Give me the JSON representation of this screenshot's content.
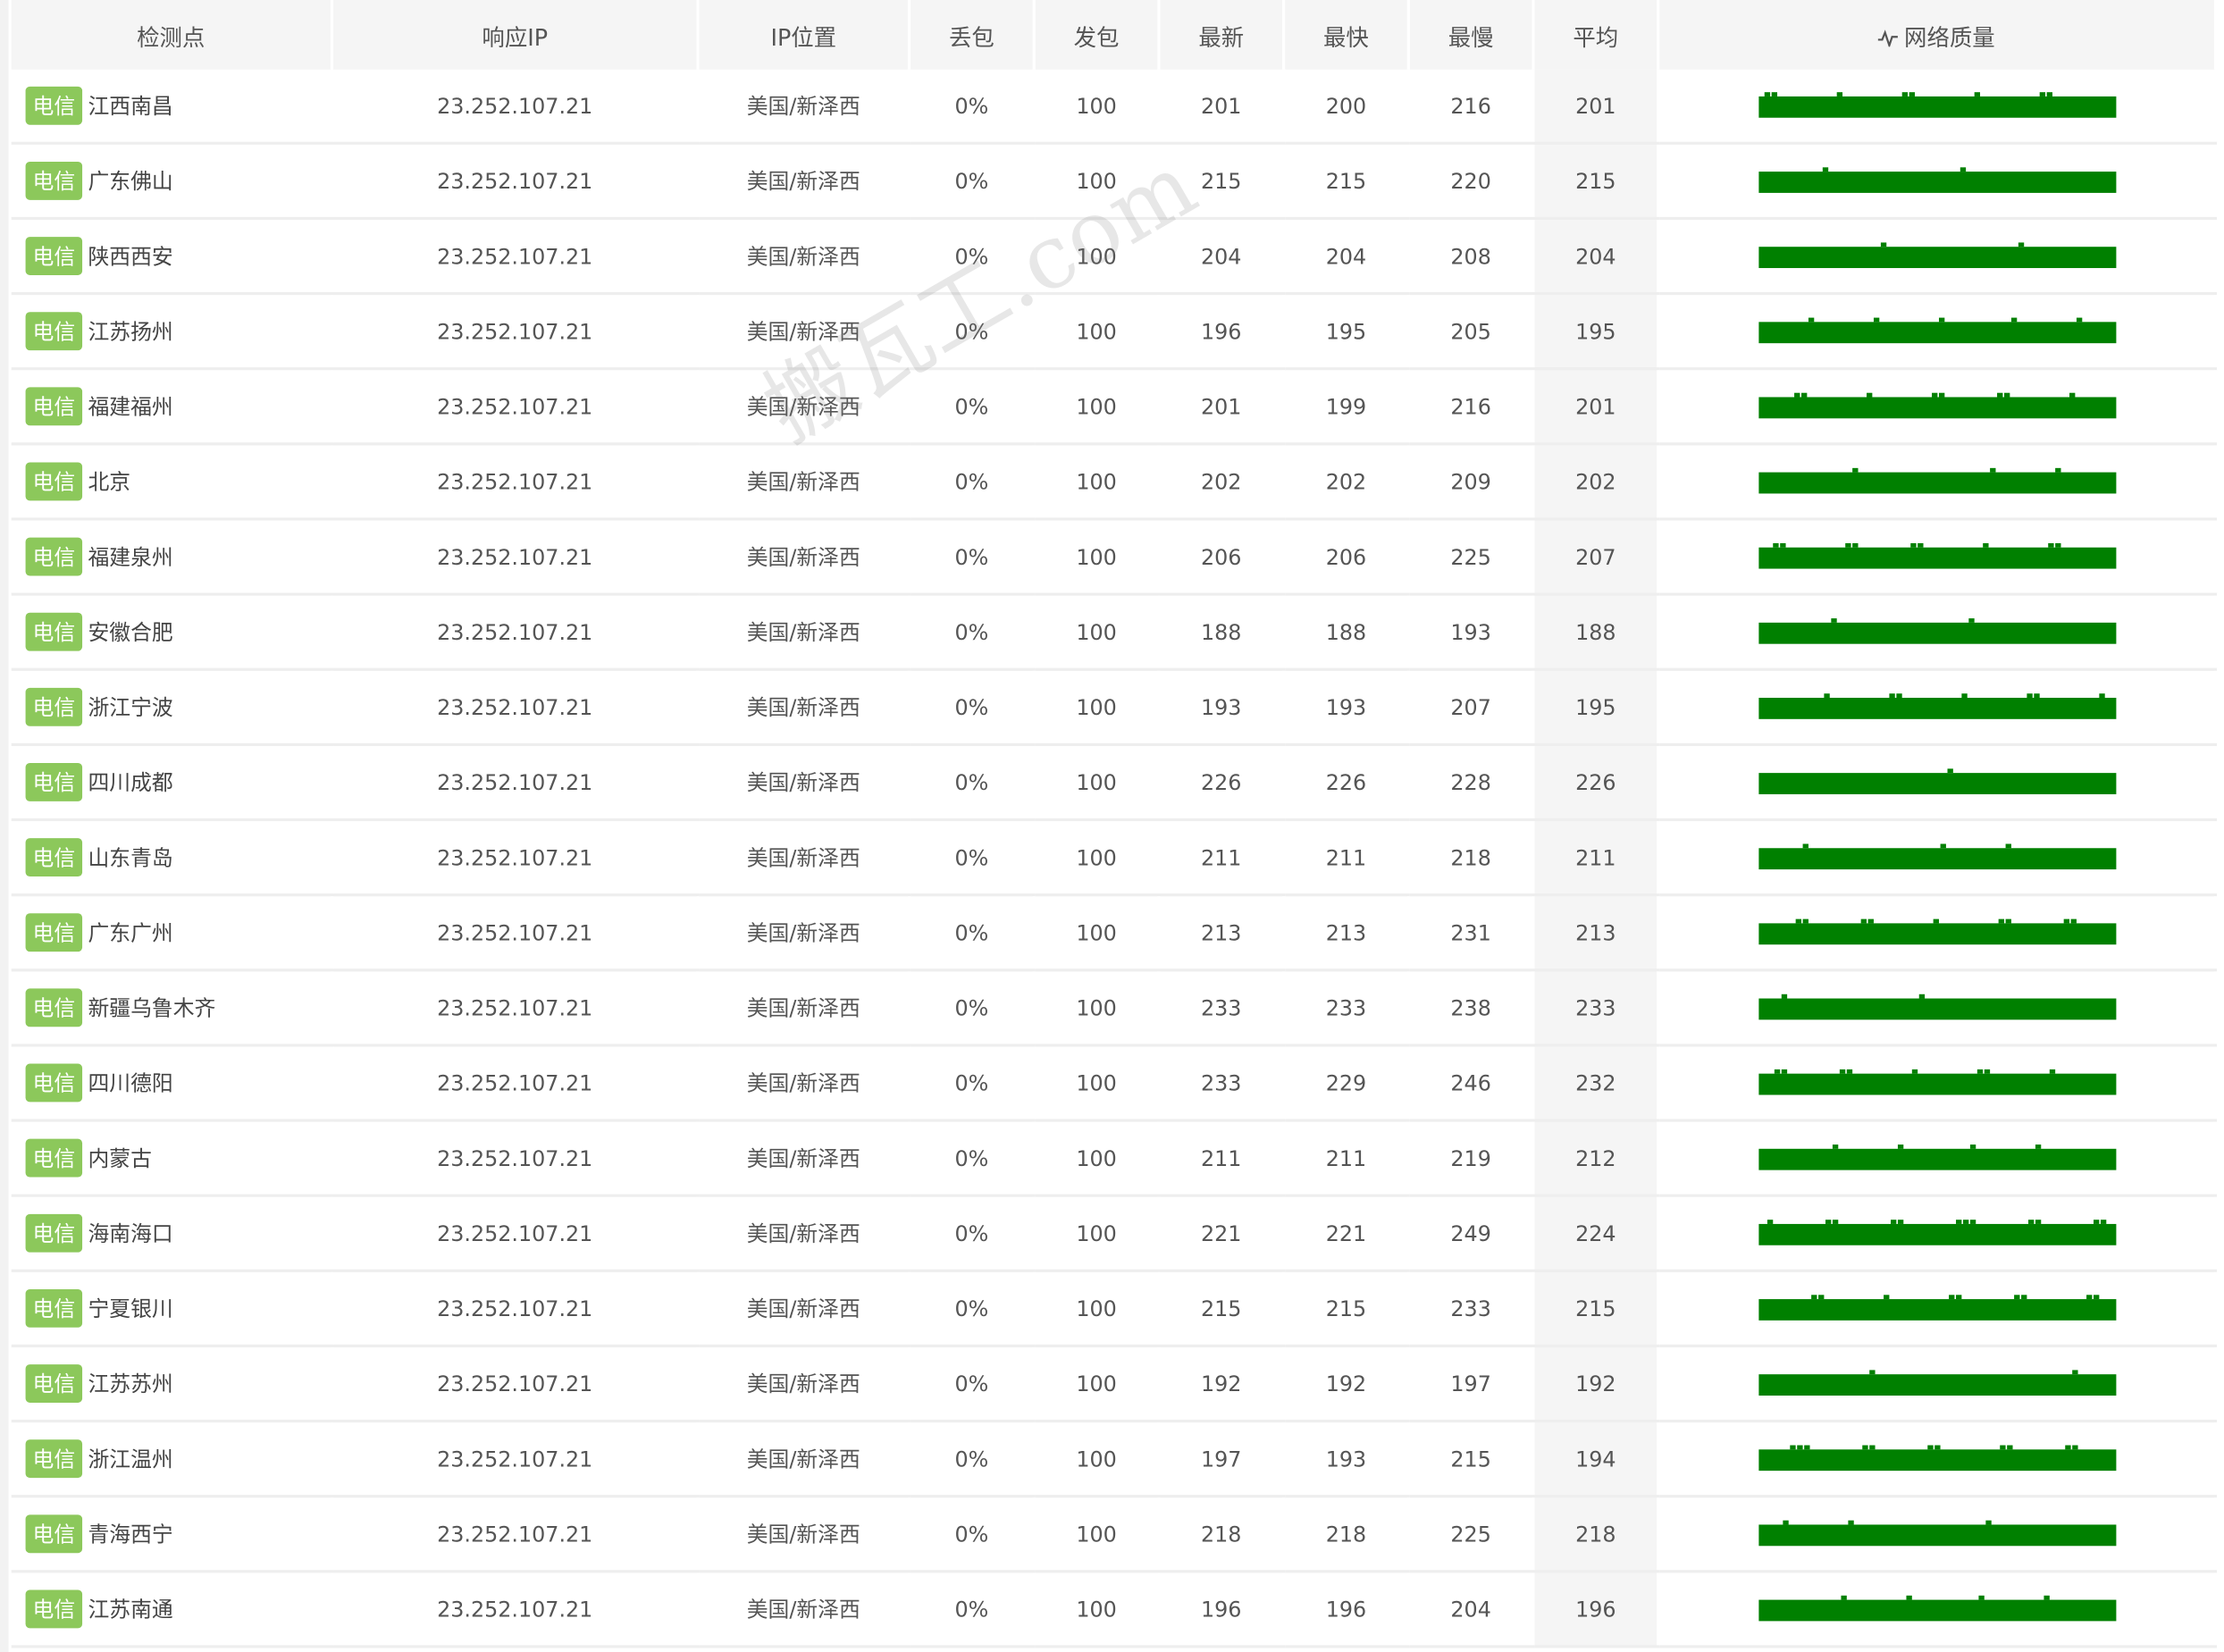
{
  "table": {
    "headers": {
      "node": "检测点",
      "ip": "响应IP",
      "location": "IP位置",
      "loss": "丢包",
      "sent": "发包",
      "latest": "最新",
      "fastest": "最快",
      "slowest": "最慢",
      "average": "平均",
      "quality": "网络质量"
    },
    "rows": [
      {
        "isp": "电信",
        "node": "江西南昌",
        "ip": "23.252.107.21",
        "location": "美国/新泽西",
        "loss": "0%",
        "sent": "100",
        "latest": "201",
        "fastest": "200",
        "slowest": "216",
        "average": "201"
      },
      {
        "isp": "电信",
        "node": "广东佛山",
        "ip": "23.252.107.21",
        "location": "美国/新泽西",
        "loss": "0%",
        "sent": "100",
        "latest": "215",
        "fastest": "215",
        "slowest": "220",
        "average": "215"
      },
      {
        "isp": "电信",
        "node": "陕西西安",
        "ip": "23.252.107.21",
        "location": "美国/新泽西",
        "loss": "0%",
        "sent": "100",
        "latest": "204",
        "fastest": "204",
        "slowest": "208",
        "average": "204"
      },
      {
        "isp": "电信",
        "node": "江苏扬州",
        "ip": "23.252.107.21",
        "location": "美国/新泽西",
        "loss": "0%",
        "sent": "100",
        "latest": "196",
        "fastest": "195",
        "slowest": "205",
        "average": "195"
      },
      {
        "isp": "电信",
        "node": "福建福州",
        "ip": "23.252.107.21",
        "location": "美国/新泽西",
        "loss": "0%",
        "sent": "100",
        "latest": "201",
        "fastest": "199",
        "slowest": "216",
        "average": "201"
      },
      {
        "isp": "电信",
        "node": "北京",
        "ip": "23.252.107.21",
        "location": "美国/新泽西",
        "loss": "0%",
        "sent": "100",
        "latest": "202",
        "fastest": "202",
        "slowest": "209",
        "average": "202"
      },
      {
        "isp": "电信",
        "node": "福建泉州",
        "ip": "23.252.107.21",
        "location": "美国/新泽西",
        "loss": "0%",
        "sent": "100",
        "latest": "206",
        "fastest": "206",
        "slowest": "225",
        "average": "207"
      },
      {
        "isp": "电信",
        "node": "安徽合肥",
        "ip": "23.252.107.21",
        "location": "美国/新泽西",
        "loss": "0%",
        "sent": "100",
        "latest": "188",
        "fastest": "188",
        "slowest": "193",
        "average": "188"
      },
      {
        "isp": "电信",
        "node": "浙江宁波",
        "ip": "23.252.107.21",
        "location": "美国/新泽西",
        "loss": "0%",
        "sent": "100",
        "latest": "193",
        "fastest": "193",
        "slowest": "207",
        "average": "195"
      },
      {
        "isp": "电信",
        "node": "四川成都",
        "ip": "23.252.107.21",
        "location": "美国/新泽西",
        "loss": "0%",
        "sent": "100",
        "latest": "226",
        "fastest": "226",
        "slowest": "228",
        "average": "226"
      },
      {
        "isp": "电信",
        "node": "山东青岛",
        "ip": "23.252.107.21",
        "location": "美国/新泽西",
        "loss": "0%",
        "sent": "100",
        "latest": "211",
        "fastest": "211",
        "slowest": "218",
        "average": "211"
      },
      {
        "isp": "电信",
        "node": "广东广州",
        "ip": "23.252.107.21",
        "location": "美国/新泽西",
        "loss": "0%",
        "sent": "100",
        "latest": "213",
        "fastest": "213",
        "slowest": "231",
        "average": "213"
      },
      {
        "isp": "电信",
        "node": "新疆乌鲁木齐",
        "ip": "23.252.107.21",
        "location": "美国/新泽西",
        "loss": "0%",
        "sent": "100",
        "latest": "233",
        "fastest": "233",
        "slowest": "238",
        "average": "233"
      },
      {
        "isp": "电信",
        "node": "四川德阳",
        "ip": "23.252.107.21",
        "location": "美国/新泽西",
        "loss": "0%",
        "sent": "100",
        "latest": "233",
        "fastest": "229",
        "slowest": "246",
        "average": "232"
      },
      {
        "isp": "电信",
        "node": "内蒙古",
        "ip": "23.252.107.21",
        "location": "美国/新泽西",
        "loss": "0%",
        "sent": "100",
        "latest": "211",
        "fastest": "211",
        "slowest": "219",
        "average": "212"
      },
      {
        "isp": "电信",
        "node": "海南海口",
        "ip": "23.252.107.21",
        "location": "美国/新泽西",
        "loss": "0%",
        "sent": "100",
        "latest": "221",
        "fastest": "221",
        "slowest": "249",
        "average": "224"
      },
      {
        "isp": "电信",
        "node": "宁夏银川",
        "ip": "23.252.107.21",
        "location": "美国/新泽西",
        "loss": "0%",
        "sent": "100",
        "latest": "215",
        "fastest": "215",
        "slowest": "233",
        "average": "215"
      },
      {
        "isp": "电信",
        "node": "江苏苏州",
        "ip": "23.252.107.21",
        "location": "美国/新泽西",
        "loss": "0%",
        "sent": "100",
        "latest": "192",
        "fastest": "192",
        "slowest": "197",
        "average": "192"
      },
      {
        "isp": "电信",
        "node": "浙江温州",
        "ip": "23.252.107.21",
        "location": "美国/新泽西",
        "loss": "0%",
        "sent": "100",
        "latest": "197",
        "fastest": "193",
        "slowest": "215",
        "average": "194"
      },
      {
        "isp": "电信",
        "node": "青海西宁",
        "ip": "23.252.107.21",
        "location": "美国/新泽西",
        "loss": "0%",
        "sent": "100",
        "latest": "218",
        "fastest": "218",
        "slowest": "225",
        "average": "218"
      },
      {
        "isp": "电信",
        "node": "江苏南通",
        "ip": "23.252.107.21",
        "location": "美国/新泽西",
        "loss": "0%",
        "sent": "100",
        "latest": "196",
        "fastest": "196",
        "slowest": "204",
        "average": "196"
      }
    ]
  },
  "watermark": "搬瓦工.com",
  "colors": {
    "badge": "#8cc85b",
    "quality_bar": "#008000",
    "header_bg": "#f5f5f5"
  },
  "icons": {
    "quality_header": "pulse-icon"
  }
}
